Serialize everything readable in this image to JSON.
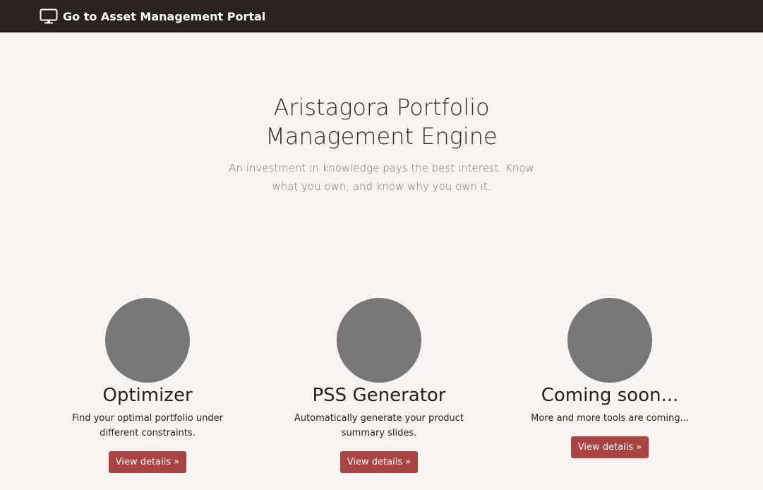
{
  "navbar": {
    "brand_label": "Go to Asset Management Portal",
    "brand_icon": "monitor-icon",
    "background": "#2b2220"
  },
  "hero": {
    "title_line1": "Aristagora Portfolio",
    "title_line2": "Management Engine",
    "lead": "An investment in knowledge pays the best interest. Know what you own, and know why you own it."
  },
  "features": [
    {
      "title": "Optimizer",
      "description": "Find your optimal portfolio under different constraints.",
      "button_label": "View details »"
    },
    {
      "title": "PSS Generator",
      "description": "Automatically generate your product summary slides.",
      "button_label": "View details »"
    },
    {
      "title": "Coming soon...",
      "description": "More and more tools are coming...",
      "button_label": "View details »"
    }
  ],
  "colors": {
    "page_background": "#f6f3f1",
    "accent_button": "#a94442",
    "placeholder_circle": "#777777"
  }
}
